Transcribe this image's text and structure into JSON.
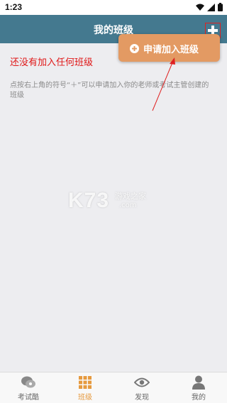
{
  "status_bar": {
    "time": "1:23"
  },
  "header": {
    "title": "我的班级",
    "add_icon": "plus-icon"
  },
  "popup": {
    "item_label": "申请加入班级",
    "item_icon": "plus-circle-icon"
  },
  "empty_state": {
    "title": "还没有加入任何班级",
    "hint": "点按右上角的符号“＋”可以申请加入你的老师或考试主管创建的班级"
  },
  "watermark": {
    "big": "K73",
    "small": "游戏之家",
    "com": ".com"
  },
  "tabs": [
    {
      "label": "考试酷",
      "icon": "chat-bubbles-icon",
      "active": false
    },
    {
      "label": "班级",
      "icon": "grid-icon",
      "active": true
    },
    {
      "label": "发现",
      "icon": "eye-icon",
      "active": false
    },
    {
      "label": "我的",
      "icon": "person-icon",
      "active": false
    }
  ],
  "colors": {
    "header": "#44798f",
    "popup": "#e39a63",
    "empty_title": "#e01818",
    "active_tab": "#e69a3f",
    "annotation": "#e02020"
  }
}
